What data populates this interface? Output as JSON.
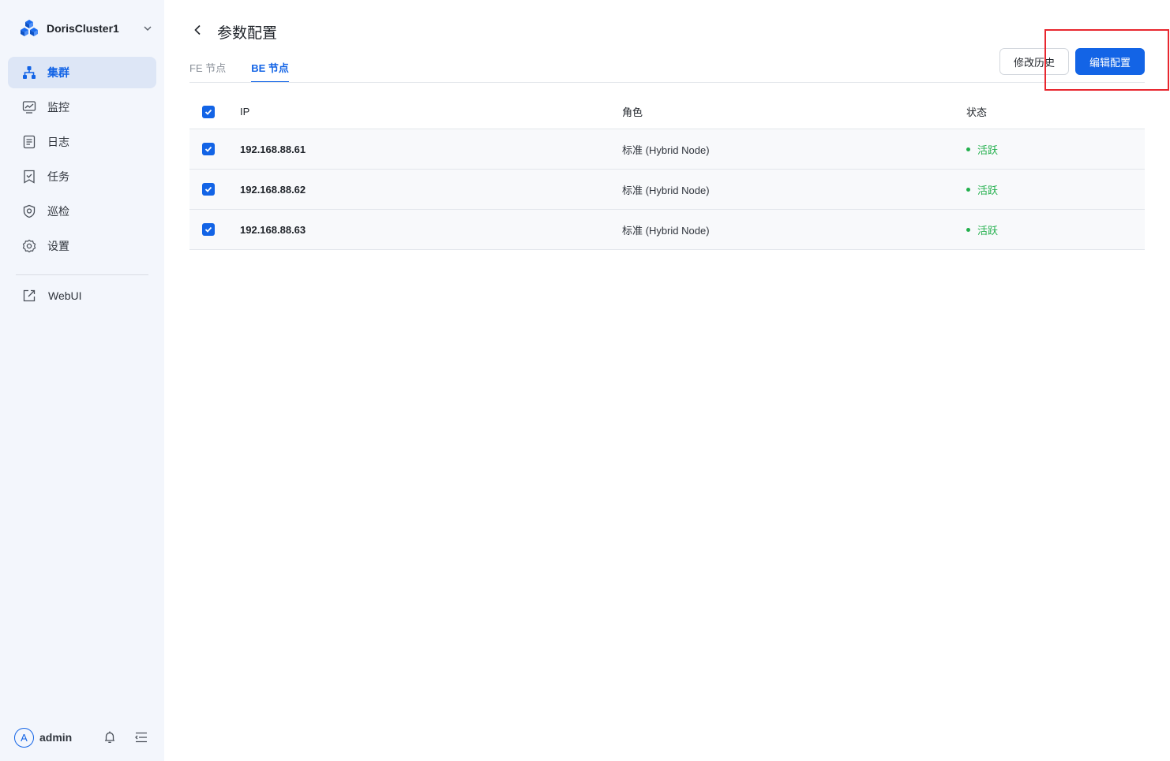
{
  "sidebar": {
    "cluster_name": "DorisCluster1",
    "nav": [
      {
        "label": "集群",
        "icon": "cluster-icon",
        "active": true
      },
      {
        "label": "监控",
        "icon": "monitor-icon",
        "active": false
      },
      {
        "label": "日志",
        "icon": "log-icon",
        "active": false
      },
      {
        "label": "任务",
        "icon": "task-icon",
        "active": false
      },
      {
        "label": "巡检",
        "icon": "shield-icon",
        "active": false
      },
      {
        "label": "设置",
        "icon": "gear-icon",
        "active": false
      }
    ],
    "webui_label": "WebUI",
    "user": {
      "avatar_letter": "A",
      "name": "admin"
    }
  },
  "header": {
    "title": "参数配置",
    "tabs": [
      {
        "label": "FE 节点",
        "active": false
      },
      {
        "label": "BE 节点",
        "active": true
      }
    ],
    "history_button": "修改历史",
    "edit_button": "编辑配置"
  },
  "table": {
    "columns": [
      "IP",
      "角色",
      "状态"
    ],
    "rows": [
      {
        "ip": "192.168.88.61",
        "role": "标准 (Hybrid Node)",
        "status": "活跃",
        "checked": true
      },
      {
        "ip": "192.168.88.62",
        "role": "标准 (Hybrid Node)",
        "status": "活跃",
        "checked": true
      },
      {
        "ip": "192.168.88.63",
        "role": "标准 (Hybrid Node)",
        "status": "活跃",
        "checked": true
      }
    ]
  },
  "colors": {
    "accent": "#1364e6",
    "status_active": "#23b04d",
    "highlight": "#e8272f",
    "sidebar_bg": "#f3f6fc"
  }
}
